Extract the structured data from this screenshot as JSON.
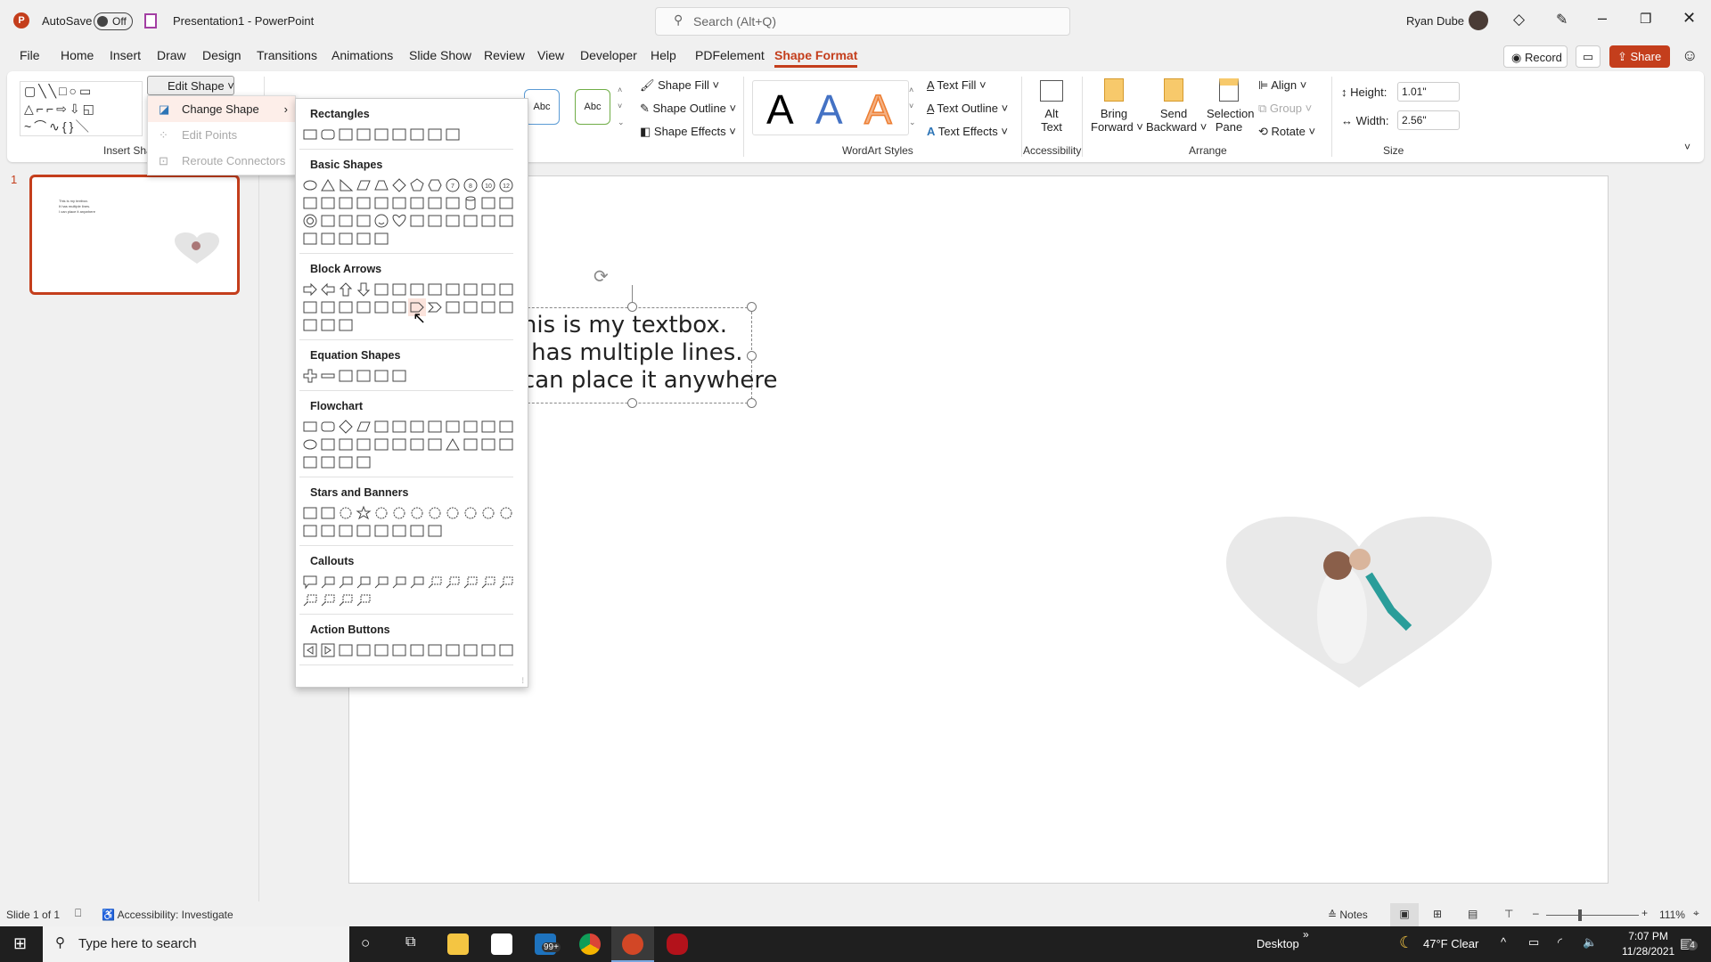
{
  "app": {
    "autosave_label": "AutoSave",
    "autosave_state": "Off",
    "title": "Presentation1  -  PowerPoint",
    "search_placeholder": "Search (Alt+Q)",
    "user": "Ryan Dube"
  },
  "tabs": [
    "File",
    "Home",
    "Insert",
    "Draw",
    "Design",
    "Transitions",
    "Animations",
    "Slide Show",
    "Review",
    "View",
    "Developer",
    "Help",
    "PDFelement",
    "Shape Format"
  ],
  "active_tab": "Shape Format",
  "actions": {
    "record": "Record",
    "share": "Share"
  },
  "ribbon": {
    "edit_shape": "Edit Shape",
    "insert_shapes_label": "Insert Sha",
    "style_abc": [
      "Abc",
      "Abc"
    ],
    "shape_fill": "Shape Fill",
    "shape_outline": "Shape Outline",
    "shape_effects": "Shape Effects",
    "wordart_letter": "A",
    "wordart_label": "WordArt Styles",
    "text_fill": "Text Fill",
    "text_outline": "Text Outline",
    "text_effects": "Text Effects",
    "alt_text": [
      "Alt",
      "Text"
    ],
    "accessibility_label": "Accessibility",
    "bring_forward": [
      "Bring",
      "Forward"
    ],
    "send_backward": [
      "Send",
      "Backward"
    ],
    "selection_pane": [
      "Selection",
      "Pane"
    ],
    "align": "Align",
    "group": "Group",
    "rotate": "Rotate",
    "arrange_label": "Arrange",
    "height_label": "Height:",
    "height_value": "1.01\"",
    "width_label": "Width:",
    "width_value": "2.56\"",
    "size_label": "Size"
  },
  "edit_shape_menu": [
    {
      "label": "Change Shape",
      "enabled": true
    },
    {
      "label": "Edit Points",
      "enabled": false
    },
    {
      "label": "Reroute Connectors",
      "enabled": false
    }
  ],
  "shape_gallery": [
    {
      "title": "Rectangles",
      "shapes": [
        "rect",
        "round",
        "snip1",
        "snip2",
        "snip3",
        "sniprnd",
        "rnd1",
        "rnd2",
        "rnd3"
      ]
    },
    {
      "title": "Basic Shapes",
      "shapes": [
        "oval",
        "tri",
        "rtri",
        "para",
        "trap",
        "diamond",
        "pent",
        "hex",
        "n7",
        "n8",
        "n10",
        "n12",
        "pie",
        "chord",
        "tear",
        "frame",
        "halfframe",
        "lshape",
        "stripe",
        "cross",
        "plaque",
        "can",
        "cube",
        "bevel",
        "donut",
        "nosym",
        "blockarc",
        "folded",
        "smiley",
        "heart",
        "bolt",
        "sun",
        "moon",
        "cloud",
        "arc",
        "dbracket",
        "dbrace",
        "lbracket",
        "rbracket",
        "lbrace",
        "rbrace"
      ]
    },
    {
      "title": "Block Arrows",
      "shapes": [
        "ar",
        "al",
        "au",
        "ad",
        "alr",
        "aud",
        "quad",
        "lru",
        "bent",
        "uturn",
        "lup",
        "bup",
        "curvr",
        "curvl",
        "curvu",
        "curvd",
        "stripedr",
        "notchedr",
        "pentagon-arrow",
        "chevron",
        "rcallout",
        "dcallout",
        "lcallout",
        "ucallout",
        "lrcallout",
        "quadcallout",
        "circarrow"
      ]
    },
    {
      "title": "Equation Shapes",
      "shapes": [
        "plus",
        "minus",
        "mult",
        "div",
        "equal",
        "noteq"
      ]
    },
    {
      "title": "Flowchart",
      "shapes": [
        "rect",
        "round",
        "diamond",
        "para",
        "pred",
        "internal",
        "doc",
        "multidoc",
        "term",
        "prep",
        "manin",
        "manop",
        "oval",
        "offpage",
        "card",
        "tape",
        "sumj",
        "or",
        "collate",
        "sort",
        "tri",
        "dtri",
        "delay",
        "altproc",
        "seq",
        "disk",
        "direct",
        "display"
      ]
    },
    {
      "title": "Stars and Banners",
      "shapes": [
        "exp1",
        "exp2",
        "s4",
        "s5",
        "s6",
        "s7",
        "s8",
        "s10",
        "s12",
        "s16",
        "s24",
        "s32",
        "rib1",
        "rib2",
        "rib3",
        "rib4",
        "scrollv",
        "scrollh",
        "wave",
        "dwave"
      ]
    },
    {
      "title": "Callouts",
      "shapes": [
        "c1",
        "c2",
        "c3",
        "c4",
        "c5",
        "c6",
        "c7",
        "c8",
        "c9",
        "c10",
        "c11",
        "c12",
        "c13",
        "c14",
        "c15",
        "c16"
      ]
    },
    {
      "title": "Action Buttons",
      "shapes": [
        "back",
        "fwd",
        "begin",
        "end",
        "home",
        "info",
        "return",
        "movie",
        "document",
        "sound",
        "help",
        "blank"
      ]
    }
  ],
  "hovered_shape": "pentagon-arrow",
  "slide_panel": {
    "number": "1",
    "thumb_lines": [
      "This is my textbox.",
      "It has multiple lines.",
      "I can place it anywhere"
    ]
  },
  "textbox": {
    "lines": [
      "This is my textbox.",
      "It has multiple lines.",
      "I can place it anywhere"
    ]
  },
  "status": {
    "slide": "Slide 1 of 1",
    "accessibility": "Accessibility: Investigate",
    "notes": "Notes",
    "zoom": "111%",
    "zoom_value": 111
  },
  "taskbar": {
    "search_placeholder": "Type here to search",
    "mail_badge": "99+",
    "desktop": "Desktop",
    "weather": "47°F  Clear",
    "time": "7:07 PM",
    "date": "11/28/2021",
    "notifications": "4"
  },
  "colors": {
    "accent": "#c43e1c",
    "share": "#c43e1c",
    "taskbar": "#1f1f1f"
  }
}
